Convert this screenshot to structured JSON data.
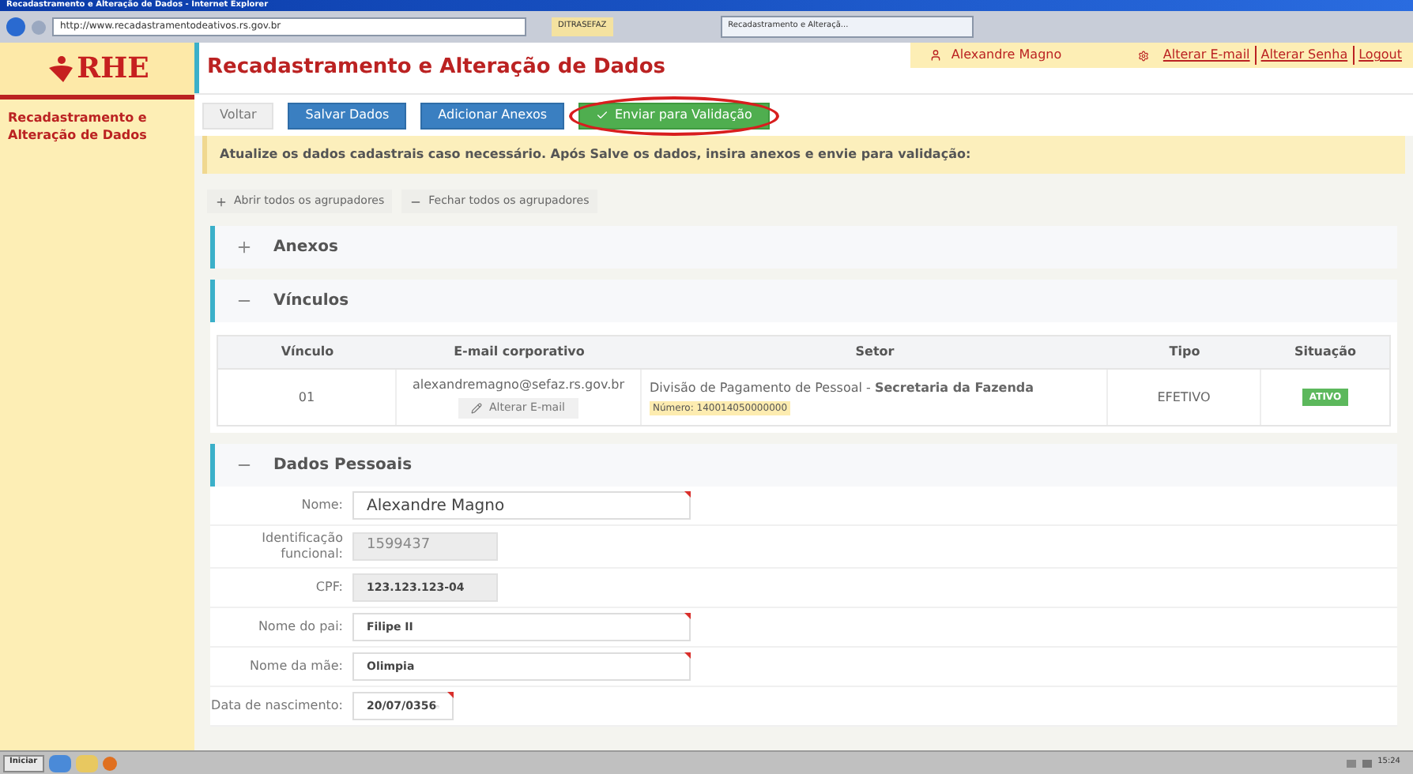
{
  "browser": {
    "title": "Recadastramento e Alteração de Dados - Internet Explorer",
    "address": "http://www.recadastramentodeativos.rs.gov.br",
    "favorites_tab": "DITRASEFAZ",
    "tabs": [
      {
        "label": "Recadastramento e Alteraçã...",
        "selected": true
      }
    ]
  },
  "logo": {
    "text": "RHE"
  },
  "sidebar": {
    "items": [
      {
        "label": "Recadastramento e Alteração de Dados",
        "selected": true
      }
    ]
  },
  "header": {
    "title": "Recadastramento e Alteração de Dados",
    "user": "Alexandre Magno",
    "links": [
      "Alterar E-mail",
      "Alterar Senha",
      "Logout"
    ]
  },
  "toolbar": [
    {
      "label": "Voltar",
      "kind": "default",
      "highlighted": false
    },
    {
      "label": "Salvar Dados",
      "kind": "primary",
      "highlighted": false
    },
    {
      "label": "Adicionar Anexos",
      "kind": "primary",
      "highlighted": false
    },
    {
      "label": "Enviar para Validação",
      "kind": "success",
      "highlighted": true
    }
  ],
  "notice": "Atualize os dados cadastrais caso necessário. Após Salve os dados, insira anexos e envie para validação:",
  "group_actions": [
    {
      "label": "Abrir todos os agrupadores",
      "kind": "expand"
    },
    {
      "label": "Fechar todos os agrupadores",
      "kind": "collapse"
    }
  ],
  "sections": [
    {
      "title": "Anexos",
      "expanded": false
    },
    {
      "title": "Vínculos",
      "expanded": true,
      "table": {
        "columns": [
          "Vínculo",
          "E-mail corporativo",
          "Setor",
          "Tipo",
          "Situação"
        ],
        "rows": [
          {
            "vinculo": "01",
            "email": "alexandremagno@sefaz.rs.gov.br",
            "email_button": "Alterar E-mail",
            "setor": "Divisão de Pagamento de Pessoal - **Secretaria da Fazenda**",
            "numero": "Número: 140014050000000",
            "tipo": "EFETIVO",
            "situacao": {
              "label": "ATIVO",
              "color": "#5cb85c"
            }
          }
        ]
      }
    },
    {
      "title": "Dados Pessoais",
      "expanded": true,
      "fields": [
        {
          "label": "Nome:",
          "value": "Alexandre Magno",
          "kind": "text",
          "required": true
        },
        {
          "label": "Identificação funcional:",
          "value": "1599437",
          "kind": "readonly",
          "required": false
        },
        {
          "label": "CPF:",
          "value": "123.123.123-04",
          "kind": "readonly",
          "required": false
        },
        {
          "label": "Nome do pai:",
          "value": "Filipe II",
          "kind": "text",
          "required": true
        },
        {
          "label": "Nome da mãe:",
          "value": "Olimpia",
          "kind": "text",
          "required": true
        },
        {
          "label": "Data de nascimento:",
          "value": "20/07/0356",
          "kind": "date",
          "required": true
        }
      ]
    }
  ],
  "taskbar": {
    "start": "Iniciar",
    "clock": "15:24"
  }
}
